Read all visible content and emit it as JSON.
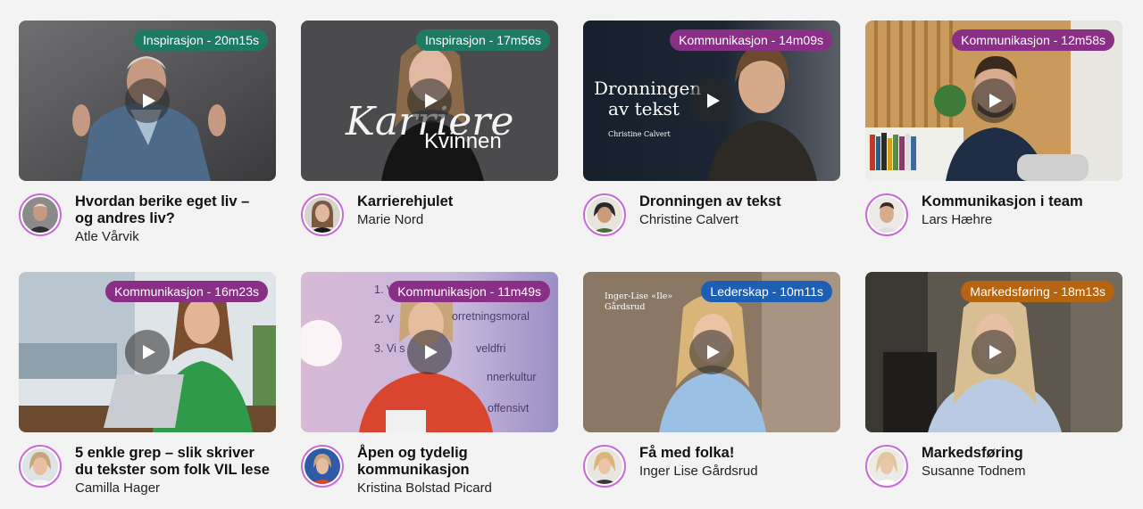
{
  "cards": [
    {
      "badge": "Inspirasjon - 20m15s",
      "badge_color": "#1f7a64",
      "title": "Hvordan berike eget liv – og andres liv?",
      "author": "Atle Vårvik"
    },
    {
      "badge": "Inspirasjon - 17m56s",
      "badge_color": "#1f7a64",
      "title": "Karrierehjulet",
      "author": "Marie Nord",
      "overlay_script": "Karriere",
      "overlay_sans": "Kvinnen"
    },
    {
      "badge": "Kommunikasjon - 14m09s",
      "badge_color": "#8a2f86",
      "title": "Dronningen av tekst",
      "author": "Christine Calvert",
      "overlay_line1": "Dronningen",
      "overlay_line2": "av tekst",
      "overlay_small": "Christine Calvert"
    },
    {
      "badge": "Kommunikasjon - 12m58s",
      "badge_color": "#8a2f86",
      "title": "Kommunikasjon i team",
      "author": "Lars Hæhre"
    },
    {
      "badge": "Kommunikasjon - 16m23s",
      "badge_color": "#8a2f86",
      "title": "5 enkle grep – slik skriver du tekster som folk VIL lese",
      "author": "Camilla Hager"
    },
    {
      "badge": "Kommunikasjon - 11m49s",
      "badge_color": "#8a2f86",
      "title": "Åpen og tydelig kommunikasjon",
      "author": "Kristina Bolstad Picard",
      "slide_lines": [
        "1. Vi t",
        "2. V",
        "orretningsmoral",
        "3. Vi s",
        "veldfri",
        "nnerkultur",
        "offensivt"
      ]
    },
    {
      "badge": "Lederskap - 10m11s",
      "badge_color": "#1d5fb4",
      "title": "Få med folka!",
      "author": "Inger Lise Gårdsrud",
      "overlay_name": "Inger-Lise «Ile»",
      "overlay_name2": "Gårdsrud"
    },
    {
      "badge": "Markedsføring - 18m13s",
      "badge_color": "#b5650f",
      "title": "Markedsføring",
      "author": "Susanne Todnem"
    }
  ],
  "icons": {
    "play": "play-icon"
  }
}
